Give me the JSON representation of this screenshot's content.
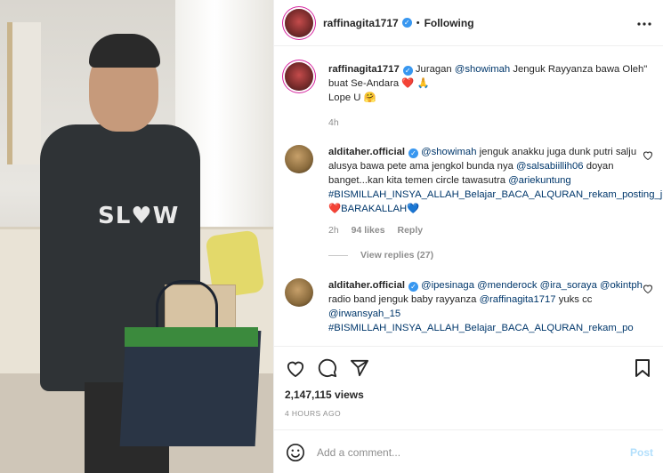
{
  "header": {
    "username": "raffinagita1717",
    "separator": "•",
    "follow_status": "Following",
    "more_icon": "more-horizontal-icon"
  },
  "media": {
    "shirt_text": "SL♥W"
  },
  "caption": {
    "username": "raffinagita1717",
    "text_prefix": "Juragan ",
    "mention": "@showimah",
    "text_suffix": " Jenguk Rayyanza bawa Oleh\" buat Se-Andara ❤️ 🙏",
    "line2": "Lope U 🤗",
    "time": "4h"
  },
  "comments": [
    {
      "username": "alditaher.official",
      "parts": [
        {
          "t": "@showimah",
          "link": true
        },
        {
          "t": " jenguk anakku juga dunk putri salju alusya bawa pete ama jengkol bunda nya ",
          "link": false
        },
        {
          "t": "@salsabiillih06",
          "link": true
        },
        {
          "t": " doyan banget...kan kita temen circle tawasutra ",
          "link": false
        },
        {
          "t": "@ariekuntung",
          "link": true
        },
        {
          "t": " ",
          "link": false
        },
        {
          "t": "#BISMILLAH_INSYA_ALLAH_Belajar_BACA_ALQURAN_rekam_posting_juga",
          "link": true
        },
        {
          "t": "❤️",
          "link": false
        },
        {
          "t": "BARAKALLAH",
          "link": true
        },
        {
          "t": "💙",
          "link": false
        }
      ],
      "time": "2h",
      "likes": "94 likes",
      "reply": "Reply",
      "view_replies": "View replies (27)"
    },
    {
      "username": "alditaher.official",
      "parts": [
        {
          "t": "@ipesinaga",
          "link": true
        },
        {
          "t": " ",
          "link": false
        },
        {
          "t": "@menderock",
          "link": true
        },
        {
          "t": " ",
          "link": false
        },
        {
          "t": "@ira_soraya",
          "link": true
        },
        {
          "t": " ",
          "link": false
        },
        {
          "t": "@okintph",
          "link": true
        },
        {
          "t": " radio band jenguk baby rayyanza ",
          "link": false
        },
        {
          "t": "@raffinagita1717",
          "link": true
        },
        {
          "t": " yuks cc ",
          "link": false
        },
        {
          "t": "@irwansyah_15",
          "link": true
        },
        {
          "t": " ",
          "link": false
        },
        {
          "t": "#BISMILLAH_INSYA_ALLAH_Belajar_BACA_ALQURAN_rekam_po",
          "link": true
        }
      ]
    }
  ],
  "actions": {
    "views": "2,147,115 views",
    "posted_ago": "4 HOURS AGO"
  },
  "add_comment": {
    "placeholder": "Add a comment...",
    "post_label": "Post"
  },
  "colors": {
    "link": "#00376b",
    "verified": "#3897f0",
    "muted": "#8e8e8e",
    "post_disabled": "#b2dffc"
  }
}
